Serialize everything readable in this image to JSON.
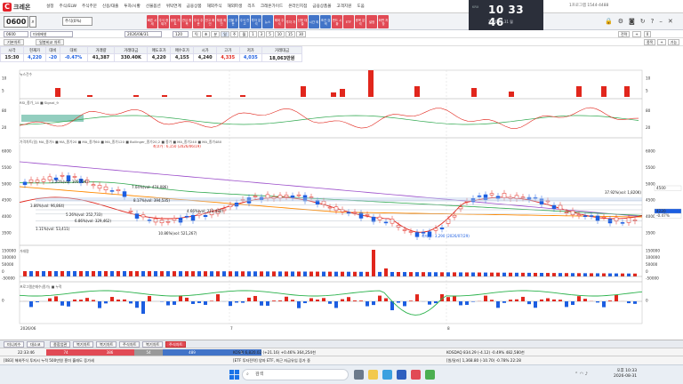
{
  "app": {
    "logo_text": "크레온",
    "menu": [
      "설정",
      "주식/ELW",
      "주식주문",
      "신용/대출",
      "투자/시황",
      "선물옵션",
      "위탁연계",
      "금융상품",
      "해외주식",
      "해외파생",
      "리츠",
      "크레온가이드",
      "온라인지점",
      "금융상품몰",
      "고객지원",
      "도움"
    ],
    "header_right": "1프로그램 1544-4488"
  },
  "toolbar": {
    "code": "0600",
    "code_search_icon": "search-icon",
    "account_select": "주식(0%)",
    "quick_buttons": [
      {
        "label": "빠른 시세",
        "color": "red"
      },
      {
        "label": "주식 현재가",
        "color": "red"
      },
      {
        "label": "종합 차트",
        "color": "red"
      },
      {
        "label": "관심 종목",
        "color": "red"
      },
      {
        "label": "주식 주문",
        "color": "red"
      },
      {
        "label": "잔고 확인",
        "color": "red"
      },
      {
        "label": "체결 확인",
        "color": "red"
      },
      {
        "label": "선물 주문",
        "color": "blue"
      },
      {
        "label": "주식 잔고",
        "color": "blue"
      },
      {
        "label": "투자 분석",
        "color": "blue"
      },
      {
        "label": "뉴스",
        "color": "blue"
      },
      {
        "label": "해외 주식",
        "color": "red"
      },
      {
        "label": "투자 자",
        "color": "red"
      },
      {
        "label": "신용 대출",
        "color": "red"
      },
      {
        "label": "시간 외",
        "color": "blue"
      },
      {
        "label": "조건 검색",
        "color": "blue"
      },
      {
        "label": "펀드 시황",
        "color": "red"
      },
      {
        "label": "ETF",
        "color": "red"
      },
      {
        "label": "종목 분석",
        "color": "red"
      },
      {
        "label": "설정",
        "color": "red"
      },
      {
        "label": "화면 저장",
        "color": "red"
      }
    ],
    "clock_time": "10 33 46",
    "clock_date": "2026.08.31 월",
    "clock_badge": "KRX",
    "right_icons": [
      "lock-icon",
      "gear-icon",
      "camera-icon",
      "refresh-icon",
      "help-icon",
      "minimize-icon",
      "maximize-icon",
      "close-icon"
    ]
  },
  "chart_controls": {
    "code": "0600",
    "name": "미래에셋",
    "date": "2026/08/31",
    "period": "120",
    "interval": "일",
    "intervals": [
      "틱",
      "초",
      "분",
      "일",
      "주",
      "월",
      "1",
      "3",
      "5",
      "10",
      "15",
      "30"
    ],
    "right_labels": [
      "전략",
      "+",
      "0"
    ],
    "tabs": [
      "기본차트",
      "일봉비교 차트"
    ],
    "tab_right": [
      "종목",
      "+",
      "기능"
    ]
  },
  "quote": {
    "headers": [
      "시각",
      "현재가",
      "대비",
      "대비",
      "거래량",
      "거래대금",
      "매도호가",
      "매수호가",
      "시가",
      "고가",
      "저가",
      "거래대금"
    ],
    "values": [
      "15:30",
      "4,220",
      "-20",
      "-0.47%",
      "41,387",
      "330.40K",
      "4,220",
      "4,155",
      "4,240",
      "4,335",
      "4,035",
      "18,063만원"
    ]
  },
  "chart": {
    "pane_labels": {
      "news": "뉴스건수",
      "rsi": "RSI_종가_14 ■ Signal_9",
      "price": "가격차트(일) MA_종가5 ■ MA_종가20 ■ MA_종가60 ■ MA_종가120 ■ Bollinger_종가20,2 ■ 종가 ■ MA_종가240 ■ MA_종가480",
      "volume": "거래량",
      "macd": "프로그램순매수(종가) ■ 누적"
    },
    "price_axis": [
      "6000",
      "5500",
      "5000",
      "4500",
      "4000",
      "3500"
    ],
    "rsi_axis": [
      "80",
      "20"
    ],
    "news_axis": [
      "10",
      "5"
    ],
    "volume_axis": [
      "150000",
      "100000",
      "50000",
      "0",
      "-50000"
    ],
    "macd_axis": [
      "0"
    ],
    "right_badges": [
      "4500",
      "4220",
      "-0.47%"
    ],
    "annotations": [
      {
        "text": "최고가 : 6,150 (2026/06/19)",
        "color": "#e1261c"
      },
      {
        "text": "최저가 : 3,290 (2026/07/29)",
        "color": "#1c5ee1"
      },
      {
        "text": "2.20%(vol: 105,724)",
        "color": "#222"
      },
      {
        "text": "3.86%(vol: 96,864)",
        "color": "#222"
      },
      {
        "text": "5.26%(vol: 252,733)",
        "color": "#222"
      },
      {
        "text": "6.86%(vol: 329,462)",
        "color": "#222"
      },
      {
        "text": "1.11%(vol: 53,411)",
        "color": "#222"
      },
      {
        "text": "10.86%(vol: 521,267)",
        "color": "#222"
      },
      {
        "text": "8.17%(vol: 394,535)",
        "color": "#222"
      },
      {
        "text": "4.66%(vol: 212,430)",
        "color": "#222"
      },
      {
        "text": "7.04%(vol: 474,086)",
        "color": "#222"
      },
      {
        "text": "37.92%(vol: 1,820K)",
        "color": "#222"
      }
    ],
    "x_labels": [
      "2026/06",
      "7",
      "8"
    ],
    "colors": {
      "up": "#e1261c",
      "down": "#1c5ee1",
      "ma5": "#e1261c",
      "ma20": "#ff8a00",
      "ma60": "#2fa84f",
      "ma120": "#9b4dca"
    }
  },
  "bottom_tabs": [
    "미니지수",
    "대소코",
    "종합업관",
    "복기차트",
    "복기차트",
    "주식차트",
    "복기차트",
    "주식차트"
  ],
  "bottom_active": 7,
  "status1": {
    "time": "22:33:46",
    "segs": [
      {
        "value": "74",
        "color": "#e14a55"
      },
      {
        "value": "386",
        "color": "#e14a55"
      },
      {
        "value": "54",
        "color": "#999"
      },
      {
        "value": "489",
        "color": "#4274c8"
      },
      {
        "value": "1",
        "color": "#4274c8"
      }
    ],
    "kospi": "KOSPI 6,820.02 (+21.16) +0.46% 364,254천",
    "kosdaq": "KOSDAQ 834.29 (-4.12) -0.49% 482,580천"
  },
  "status2": {
    "left": "[083] 해외주식 투자시 누적 500만원 흥미 홀래도 증가세",
    "mid": "[ETF 투자전략] 양자 ETF, 최근 자금유입 증가 중",
    "right": "[원/달러] 1,368.80 (-10.70) -0.78% 22:28"
  },
  "taskbar": {
    "search_placeholder": "검색",
    "tray_time": "오후 10:33",
    "tray_date": "2026-08-31"
  }
}
